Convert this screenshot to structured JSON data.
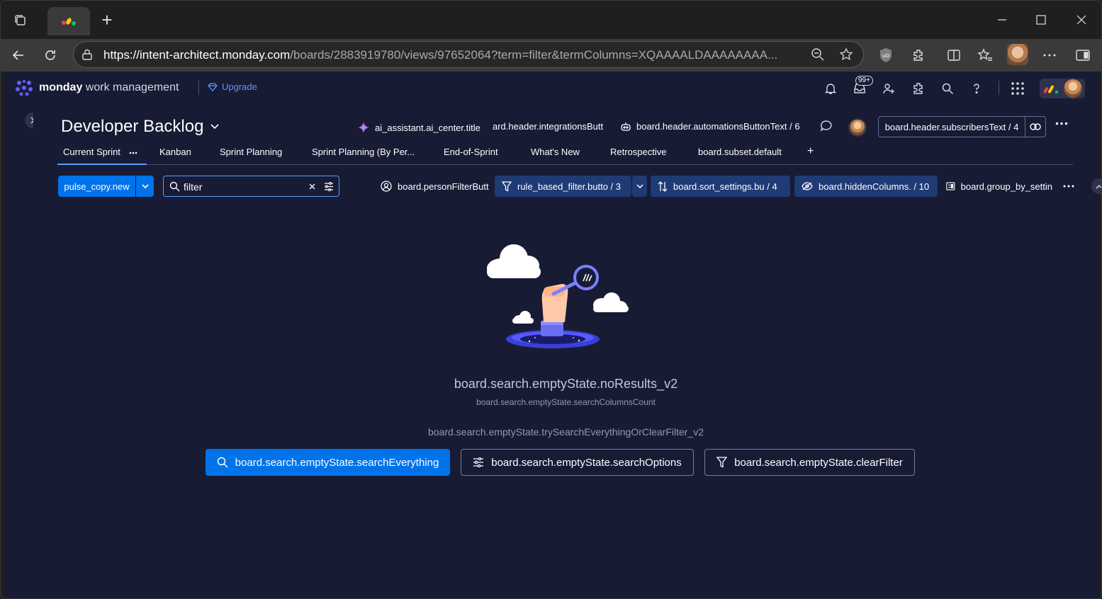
{
  "browser": {
    "url_domain": "https://intent-architect.monday.com",
    "url_path": "/boards/2883919780/views/97652064?term=filter&termColumns=XQAAAALDAAAAAAAA..."
  },
  "app": {
    "brand_bold": "monday",
    "brand_rest": "work management",
    "upgrade_label": "Upgrade",
    "notifications_badge": "99+"
  },
  "board": {
    "title": "Developer Backlog",
    "ai_assistant": "ai_assistant.ai_center.title",
    "integrations": "ard.header.integrationsButt",
    "automations": "board.header.automationsButtonText / 6",
    "subscribers": "board.header.subscribersText / 4"
  },
  "views": [
    {
      "label": "Current Sprint"
    },
    {
      "label": "Kanban"
    },
    {
      "label": "Sprint Planning"
    },
    {
      "label": "Sprint Planning (By Per..."
    },
    {
      "label": "End-of-Sprint"
    },
    {
      "label": "What's New"
    },
    {
      "label": "Retrospective"
    },
    {
      "label": "board.subset.default"
    }
  ],
  "toolbar": {
    "new_item": "pulse_copy.new",
    "search_value": "filter",
    "person": "board.personFilterButt",
    "filter": "rule_based_filter.butto / 3",
    "sort": "board.sort_settings.bu / 4",
    "hidden": "board.hiddenColumns. / 10",
    "group_by": "board.group_by_settin"
  },
  "empty_state": {
    "title": "board.search.emptyState.noResults_v2",
    "subtitle": "board.search.emptyState.searchColumnsCount",
    "hint": "board.search.emptyState.trySearchEverythingOrClearFilter_v2",
    "search_everything": "board.search.emptyState.searchEverything",
    "search_options": "board.search.emptyState.searchOptions",
    "clear_filter": "board.search.emptyState.clearFilter"
  },
  "colors": {
    "app_bg": "#181b34",
    "primary": "#0073ea",
    "accent_link": "#579bfc"
  }
}
